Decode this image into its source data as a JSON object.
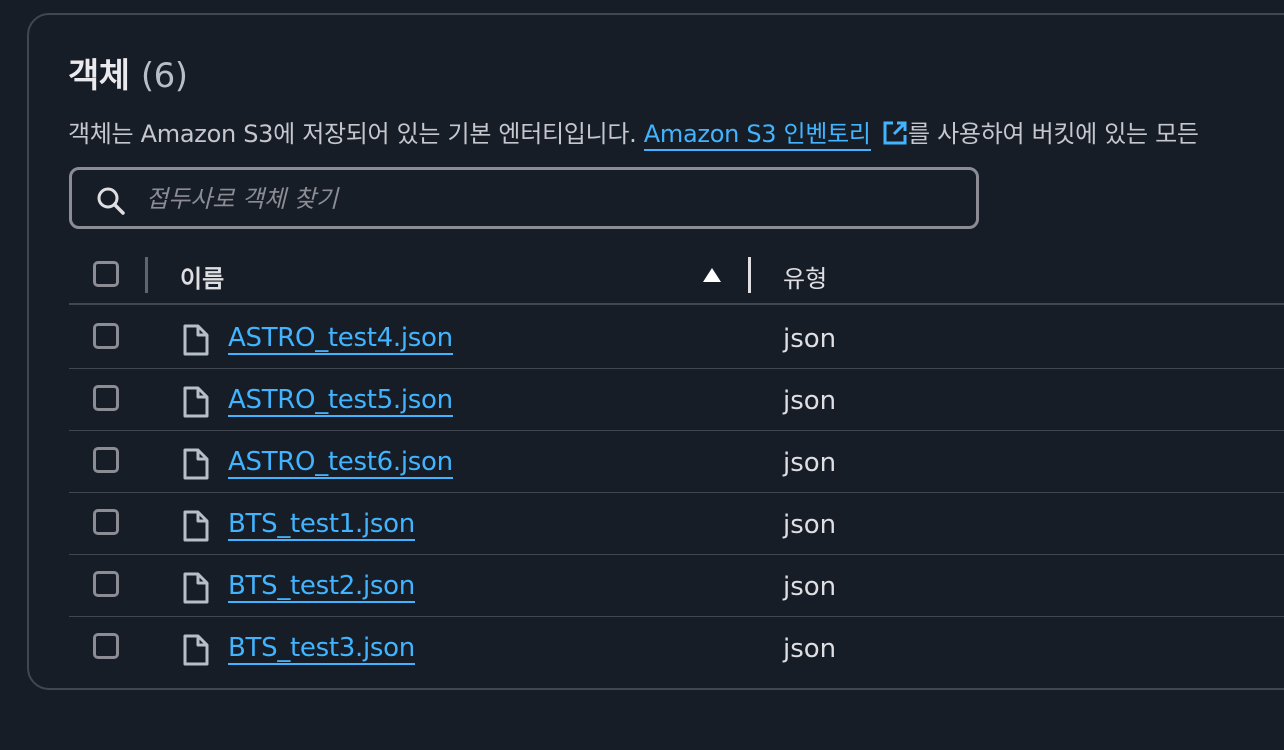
{
  "colors": {
    "background": "#161d26",
    "border": "#414750",
    "link": "#42b4ff",
    "text": "#dedee3",
    "muted": "#8c8c94"
  },
  "header": {
    "title": "객체",
    "count": "(6)"
  },
  "description": {
    "text_before": "객체는 Amazon S3에 저장되어 있는 기본 엔터티입니다.",
    "link_text": "Amazon S3 인벤토리",
    "link_icon": "external-link-icon",
    "text_after": "를 사용하여 버킷에 있는 모든"
  },
  "search": {
    "icon": "search-icon",
    "placeholder": "접두사로 객체 찾기",
    "value": ""
  },
  "table": {
    "columns": [
      {
        "label": "이름",
        "sort": "ascending"
      },
      {
        "label": "유형"
      }
    ],
    "rows": [
      {
        "name": "ASTRO_test4.json",
        "type": "json",
        "icon": "file-icon"
      },
      {
        "name": "ASTRO_test5.json",
        "type": "json",
        "icon": "file-icon"
      },
      {
        "name": "ASTRO_test6.json",
        "type": "json",
        "icon": "file-icon"
      },
      {
        "name": "BTS_test1.json",
        "type": "json",
        "icon": "file-icon"
      },
      {
        "name": "BTS_test2.json",
        "type": "json",
        "icon": "file-icon"
      },
      {
        "name": "BTS_test3.json",
        "type": "json",
        "icon": "file-icon"
      }
    ]
  }
}
